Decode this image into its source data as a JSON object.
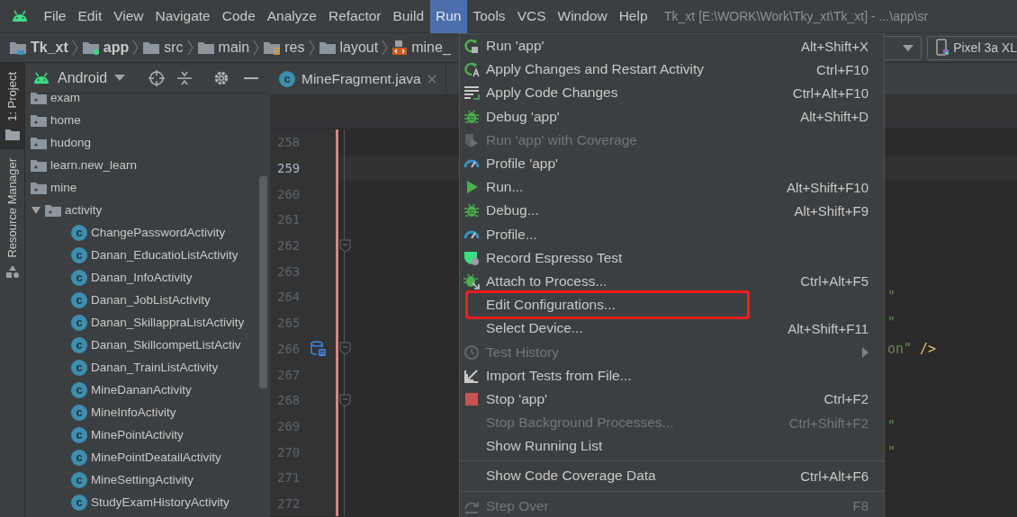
{
  "menubar": {
    "items": [
      {
        "label": "File",
        "selected": false
      },
      {
        "label": "Edit",
        "selected": false
      },
      {
        "label": "View",
        "selected": false
      },
      {
        "label": "Navigate",
        "selected": false
      },
      {
        "label": "Code",
        "selected": false
      },
      {
        "label": "Analyze",
        "selected": false
      },
      {
        "label": "Refactor",
        "selected": false
      },
      {
        "label": "Build",
        "selected": false
      },
      {
        "label": "Run",
        "selected": true
      },
      {
        "label": "Tools",
        "selected": false
      },
      {
        "label": "VCS",
        "selected": false
      },
      {
        "label": "Window",
        "selected": false
      },
      {
        "label": "Help",
        "selected": false
      }
    ]
  },
  "window_title": "Tk_xt [E:\\WORK\\Work\\Tky_xt\\Tk_xt] - ...\\app\\sr",
  "breadcrumb": [
    {
      "label": "Tk_xt",
      "bold": true
    },
    {
      "label": "app",
      "bold": true
    },
    {
      "label": "src",
      "bold": false
    },
    {
      "label": "main",
      "bold": false
    },
    {
      "label": "res",
      "bold": false
    },
    {
      "label": "layout",
      "bold": false
    },
    {
      "label": "mine_",
      "bold": false
    }
  ],
  "toolbar": {
    "device": "Pixel 3a XL"
  },
  "side_tabs": [
    {
      "label": "1: Project",
      "selected": true
    },
    {
      "label": "Resource Manager",
      "selected": false
    }
  ],
  "project": {
    "view": "Android",
    "tree": [
      {
        "label": "exam",
        "kind": "folder"
      },
      {
        "label": "home",
        "kind": "folder"
      },
      {
        "label": "hudong",
        "kind": "folder"
      },
      {
        "label": "learn.new_learn",
        "kind": "folder"
      },
      {
        "label": "mine",
        "kind": "folder"
      },
      {
        "label": "activity",
        "kind": "folder",
        "expanded": true,
        "children": [
          {
            "label": "ChangePasswordActivity",
            "kind": "class",
            "badge": "c"
          },
          {
            "label": "Danan_EducatioListActivity",
            "kind": "class",
            "badge": "c"
          },
          {
            "label": "Danan_InfoActivity",
            "kind": "class",
            "badge": "c"
          },
          {
            "label": "Danan_JobListActivity",
            "kind": "class",
            "badge": "c"
          },
          {
            "label": "Danan_SkillappraListActivity",
            "kind": "class",
            "badge": "c"
          },
          {
            "label": "Danan_SkillcompetListActiv",
            "kind": "class",
            "badge": "c"
          },
          {
            "label": "Danan_TrainListActivity",
            "kind": "class",
            "badge": "c"
          },
          {
            "label": "MineDananActivity",
            "kind": "class",
            "badge": "c"
          },
          {
            "label": "MineInfoActivity",
            "kind": "class",
            "badge": "c"
          },
          {
            "label": "MinePointActivity",
            "kind": "class",
            "badge": "c"
          },
          {
            "label": "MinePointDeatailActivity",
            "kind": "class",
            "badge": "c"
          },
          {
            "label": "MineSettingActivity",
            "kind": "class",
            "badge": "c"
          },
          {
            "label": "StudyExamHistoryActivity",
            "kind": "class",
            "badge": "c"
          }
        ]
      }
    ]
  },
  "editor": {
    "tab": {
      "label": "MineFragment.java",
      "badge": "c"
    },
    "lines": [
      {
        "number": "258",
        "current": false,
        "fold": false,
        "gutter_icon": false
      },
      {
        "number": "259",
        "current": true,
        "fold": false,
        "gutter_icon": false
      },
      {
        "number": "260",
        "current": false,
        "fold": false,
        "gutter_icon": false
      },
      {
        "number": "261",
        "current": false,
        "fold": false,
        "gutter_icon": false
      },
      {
        "number": "262",
        "current": false,
        "fold": true,
        "gutter_icon": false
      },
      {
        "number": "263",
        "current": false,
        "fold": false,
        "gutter_icon": false
      },
      {
        "number": "264",
        "current": false,
        "fold": false,
        "gutter_icon": false,
        "code": [
          {
            "text": "\"",
            "kind": "string"
          }
        ]
      },
      {
        "number": "265",
        "current": false,
        "fold": false,
        "gutter_icon": false,
        "code": [
          {
            "text": "\"",
            "kind": "string"
          }
        ]
      },
      {
        "number": "266",
        "current": false,
        "fold": true,
        "gutter_icon": true,
        "code": [
          {
            "text": "on\"",
            "kind": "string"
          },
          {
            "text": "/>",
            "kind": "tag"
          }
        ]
      },
      {
        "number": "267",
        "current": false,
        "fold": false,
        "gutter_icon": false
      },
      {
        "number": "268",
        "current": false,
        "fold": true,
        "gutter_icon": false
      },
      {
        "number": "269",
        "current": false,
        "fold": false,
        "gutter_icon": false,
        "code": [
          {
            "text": "\"",
            "kind": "string"
          }
        ]
      },
      {
        "number": "270",
        "current": false,
        "fold": false,
        "gutter_icon": false,
        "code": [
          {
            "text": "\"",
            "kind": "string"
          }
        ]
      },
      {
        "number": "271",
        "current": false,
        "fold": false,
        "gutter_icon": false
      },
      {
        "number": "272",
        "current": false,
        "fold": false,
        "gutter_icon": false
      }
    ]
  },
  "run_menu": {
    "groups": [
      [
        {
          "label": "Run 'app'",
          "shortcut": "Alt+Shift+X",
          "disabled": false,
          "submenu": false,
          "outlined": false
        },
        {
          "label": "Apply Changes and Restart Activity",
          "shortcut": "Ctrl+F10",
          "disabled": false,
          "submenu": false,
          "outlined": false
        },
        {
          "label": "Apply Code Changes",
          "shortcut": "Ctrl+Alt+F10",
          "disabled": false,
          "submenu": false,
          "outlined": false
        },
        {
          "label": "Debug 'app'",
          "shortcut": "Alt+Shift+D",
          "disabled": false,
          "submenu": false,
          "outlined": false
        },
        {
          "label": "Run 'app' with Coverage",
          "disabled": true,
          "submenu": false,
          "outlined": false
        },
        {
          "label": "Profile 'app'",
          "disabled": false,
          "submenu": false,
          "outlined": false
        },
        {
          "label": "Run...",
          "shortcut": "Alt+Shift+F10",
          "disabled": false,
          "submenu": false,
          "outlined": false
        },
        {
          "label": "Debug...",
          "shortcut": "Alt+Shift+F9",
          "disabled": false,
          "submenu": false,
          "outlined": false
        },
        {
          "label": "Profile...",
          "disabled": false,
          "submenu": false,
          "outlined": false
        },
        {
          "label": "Record Espresso Test",
          "disabled": false,
          "submenu": false,
          "outlined": false
        },
        {
          "label": "Attach to Process...",
          "shortcut": "Ctrl+Alt+F5",
          "disabled": false,
          "submenu": false,
          "outlined": false
        },
        {
          "label": "Edit Configurations...",
          "disabled": false,
          "submenu": false,
          "outlined": true
        },
        {
          "label": "Select Device...",
          "shortcut": "Alt+Shift+F11",
          "disabled": false,
          "submenu": false,
          "outlined": false
        },
        {
          "label": "Test History",
          "disabled": true,
          "submenu": true,
          "outlined": false
        },
        {
          "label": "Import Tests from File...",
          "disabled": false,
          "submenu": false,
          "outlined": false
        },
        {
          "label": "Stop 'app'",
          "shortcut": "Ctrl+F2",
          "disabled": false,
          "submenu": false,
          "outlined": false
        },
        {
          "label": "Stop Background Processes...",
          "shortcut": "Ctrl+Shift+F2",
          "disabled": true,
          "submenu": false,
          "outlined": false
        },
        {
          "label": "Show Running List",
          "disabled": false,
          "submenu": false,
          "outlined": false
        }
      ],
      [
        {
          "label": "Show Code Coverage Data",
          "shortcut": "Ctrl+Alt+F6",
          "disabled": false,
          "submenu": false,
          "outlined": false
        }
      ],
      [
        {
          "label": "Step Over",
          "shortcut": "F8",
          "disabled": true,
          "submenu": false,
          "outlined": false
        }
      ]
    ]
  }
}
